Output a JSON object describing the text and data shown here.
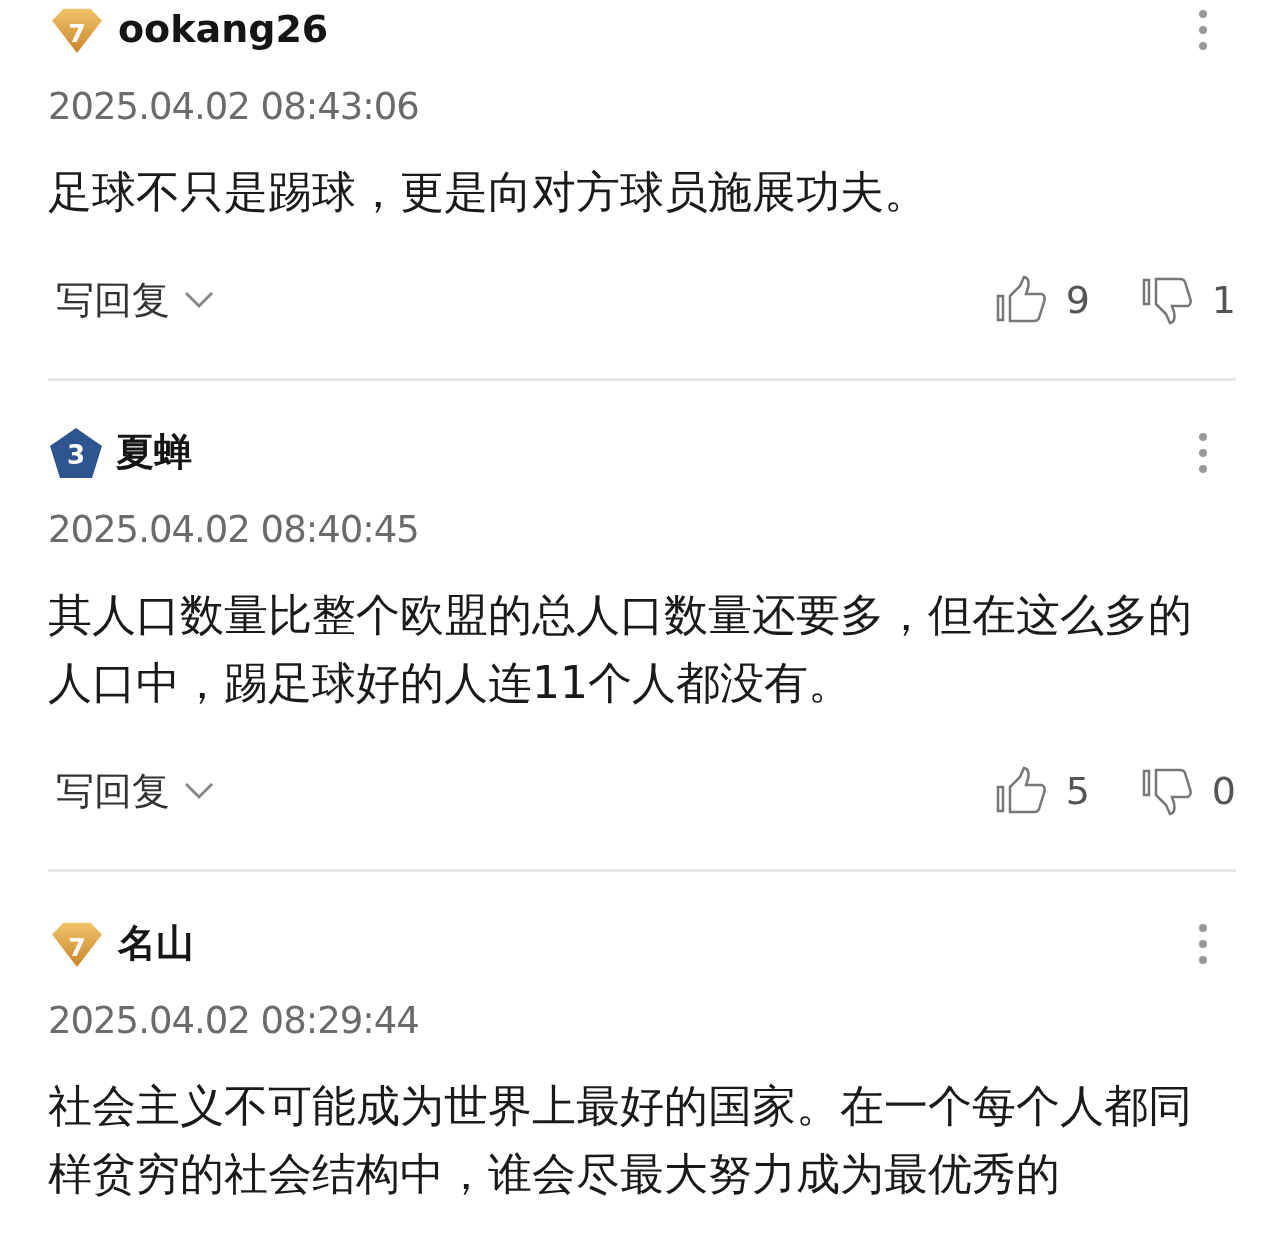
{
  "comments": [
    {
      "badge": {
        "kind": "gold",
        "level": "7"
      },
      "username": "ookang26",
      "time": "2025.04.02 08:43:06",
      "text": "足球不只是踢球，更是向对方球员施展功夫。",
      "reply": "写回复",
      "likes": "9",
      "dislikes": "1"
    },
    {
      "badge": {
        "kind": "blue",
        "level": "3"
      },
      "username": "夏蝉",
      "time": "2025.04.02 08:40:45",
      "text": "其人口数量比整个欧盟的总人口数量还要多，但在这么多的人口中，踢足球好的人连11个人都没有。",
      "reply": "写回复",
      "likes": "5",
      "dislikes": "0"
    },
    {
      "badge": {
        "kind": "gold",
        "level": "7"
      },
      "username": "名山",
      "time": "2025.04.02 08:29:44",
      "text": "社会主义不可能成为世界上最好的国家。在一个每个人都同样贫穷的社会结构中，谁会尽最大努力成为最优秀的"
    }
  ]
}
